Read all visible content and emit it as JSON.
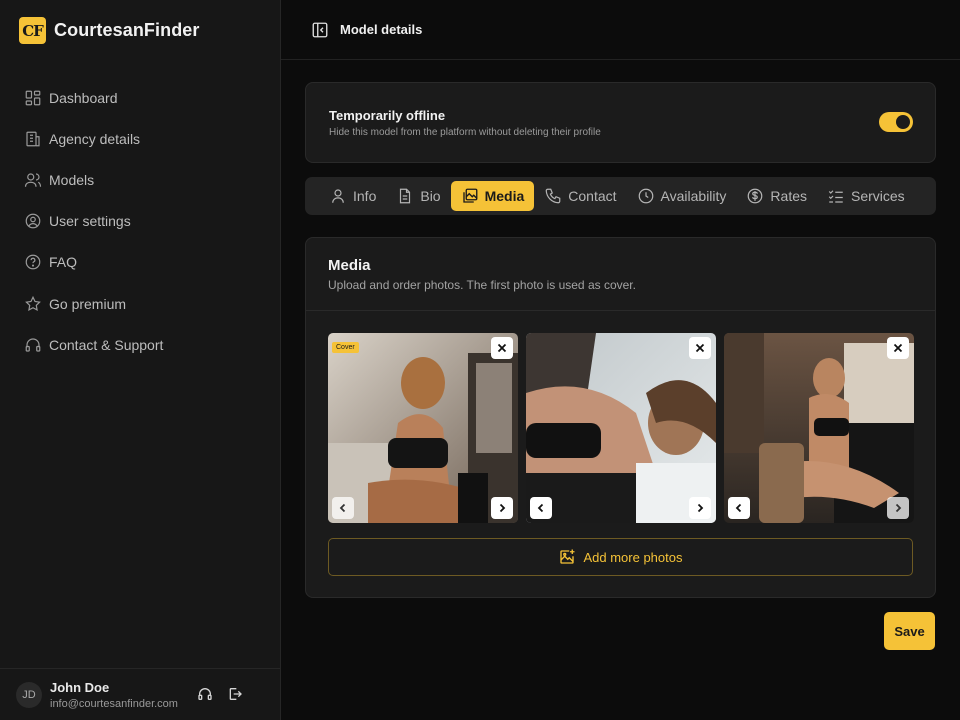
{
  "brand": {
    "logo": "CF",
    "name": "CourtesanFinder"
  },
  "sidebar": {
    "items": [
      {
        "label": "Dashboard",
        "icon": "grid-icon"
      },
      {
        "label": "Agency details",
        "icon": "building-icon"
      },
      {
        "label": "Models",
        "icon": "users-icon"
      },
      {
        "label": "User settings",
        "icon": "user-circle-icon"
      },
      {
        "label": "FAQ",
        "icon": "help-circle-icon"
      },
      {
        "label": "Go premium",
        "icon": "star-icon"
      },
      {
        "label": "Contact & Support",
        "icon": "headphones-icon"
      }
    ]
  },
  "user": {
    "initials": "JD",
    "name": "John Doe",
    "email": "info@courtesanfinder.com"
  },
  "header": {
    "title": "Model details"
  },
  "offline": {
    "title": "Temporarily offline",
    "description": "Hide this model from the platform without deleting their profile",
    "enabled": true
  },
  "tabs": [
    {
      "label": "Info",
      "icon": "user-icon"
    },
    {
      "label": "Bio",
      "icon": "document-icon"
    },
    {
      "label": "Media",
      "icon": "images-icon",
      "active": true
    },
    {
      "label": "Contact",
      "icon": "phone-icon"
    },
    {
      "label": "Availability",
      "icon": "clock-icon"
    },
    {
      "label": "Rates",
      "icon": "dollar-icon"
    },
    {
      "label": "Services",
      "icon": "checklist-icon"
    }
  ],
  "media": {
    "title": "Media",
    "description": "Upload and order photos. The first photo is used as cover.",
    "cover_label": "Cover",
    "photos": [
      {
        "alt": "photo-1"
      },
      {
        "alt": "photo-2"
      },
      {
        "alt": "photo-3"
      }
    ],
    "add_more_label": "Add more photos"
  },
  "save_label": "Save",
  "colors": {
    "accent": "#f5c237",
    "background": "#0c0c0c",
    "card": "#1b1b1b",
    "sidebar": "#171717"
  }
}
